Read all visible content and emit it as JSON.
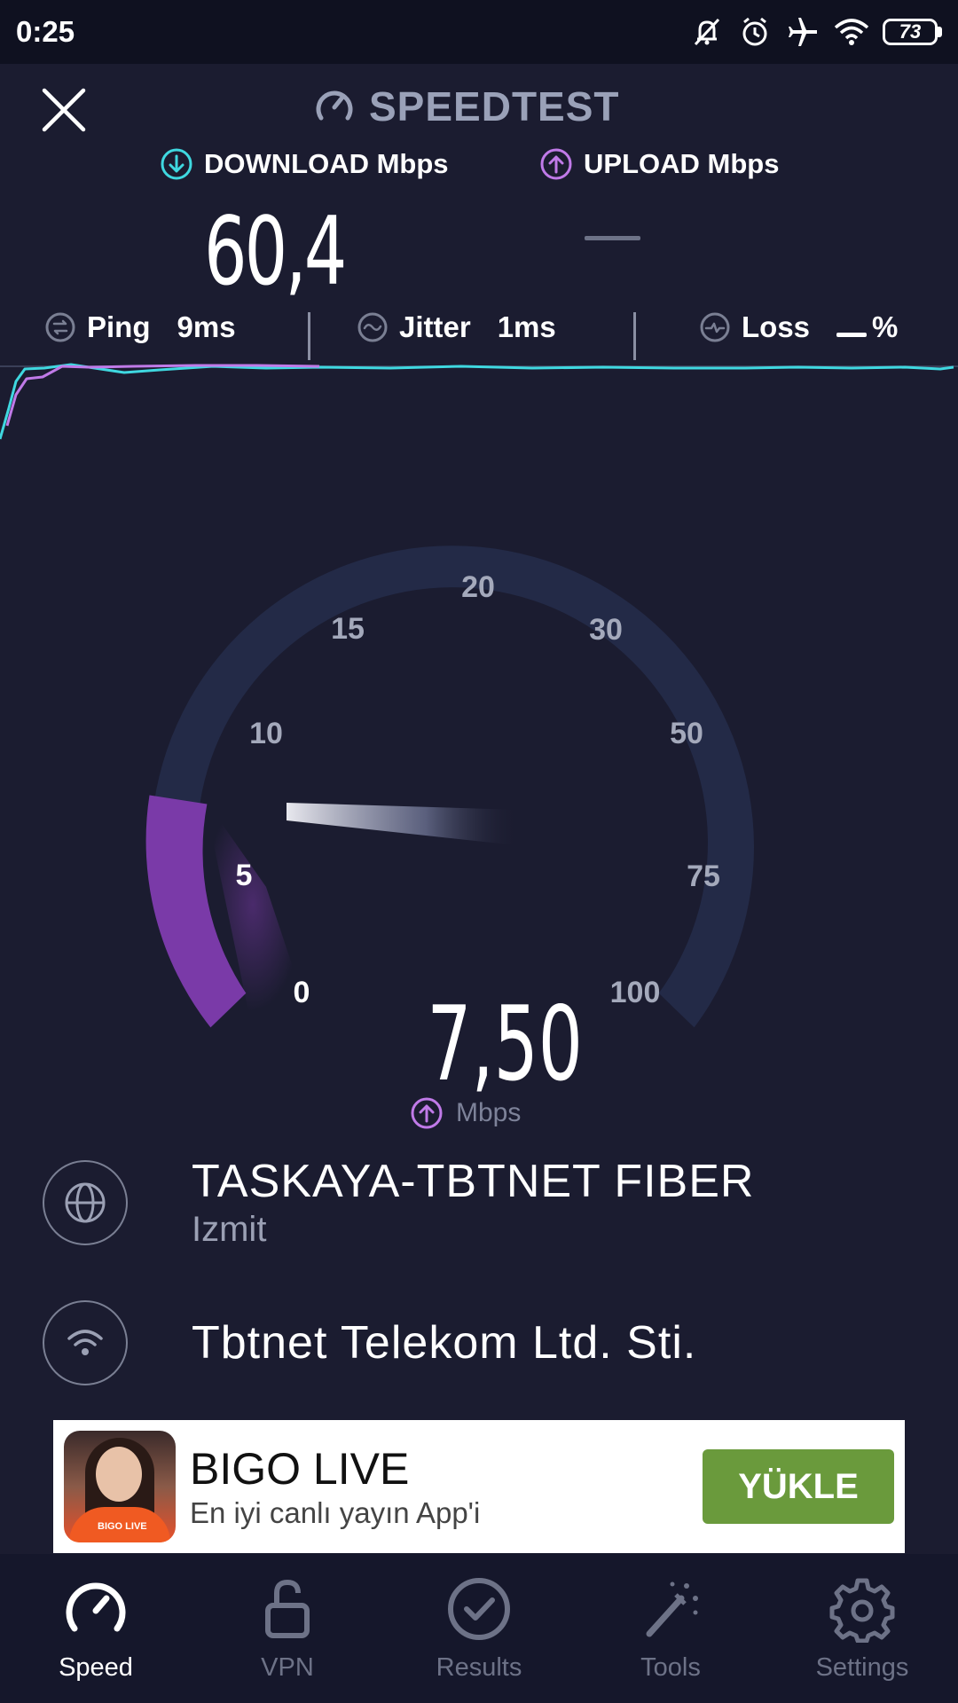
{
  "status_bar": {
    "time": "0:25",
    "battery": "73"
  },
  "header": {
    "brand": "SPEEDTEST"
  },
  "download": {
    "label": "DOWNLOAD Mbps",
    "value": "60,4"
  },
  "upload": {
    "label": "UPLOAD Mbps",
    "value": ""
  },
  "stats": {
    "ping_label": "Ping",
    "ping_value": "9ms",
    "jitter_label": "Jitter",
    "jitter_value": "1ms",
    "loss_label": "Loss",
    "loss_value": "%"
  },
  "gauge": {
    "ticks": [
      "0",
      "5",
      "10",
      "15",
      "20",
      "30",
      "50",
      "75",
      "100"
    ],
    "current_value": "7,50",
    "unit": "Mbps"
  },
  "server": {
    "name": "TASKAYA-TBTNET FIBER",
    "location": "Izmit"
  },
  "isp": {
    "name": "Tbtnet Telekom Ltd. Sti."
  },
  "ad": {
    "title": "BIGO LIVE",
    "subtitle": "En iyi canlı yayın App'i",
    "button": "YÜKLE",
    "image_label": "BIGO LIVE"
  },
  "nav": {
    "items": [
      {
        "label": "Speed",
        "icon": "speed-gauge-icon"
      },
      {
        "label": "VPN",
        "icon": "unlock-icon"
      },
      {
        "label": "Results",
        "icon": "check-circle-icon"
      },
      {
        "label": "Tools",
        "icon": "magic-wand-icon"
      },
      {
        "label": "Settings",
        "icon": "gear-icon"
      }
    ]
  },
  "colors": {
    "background": "#1b1c30",
    "download_accent": "#3fd8e0",
    "upload_accent": "#c07ae8",
    "gauge_track": "#232a47",
    "gauge_fill": "#7a3aa8",
    "ad_button": "#6a9a3c"
  }
}
